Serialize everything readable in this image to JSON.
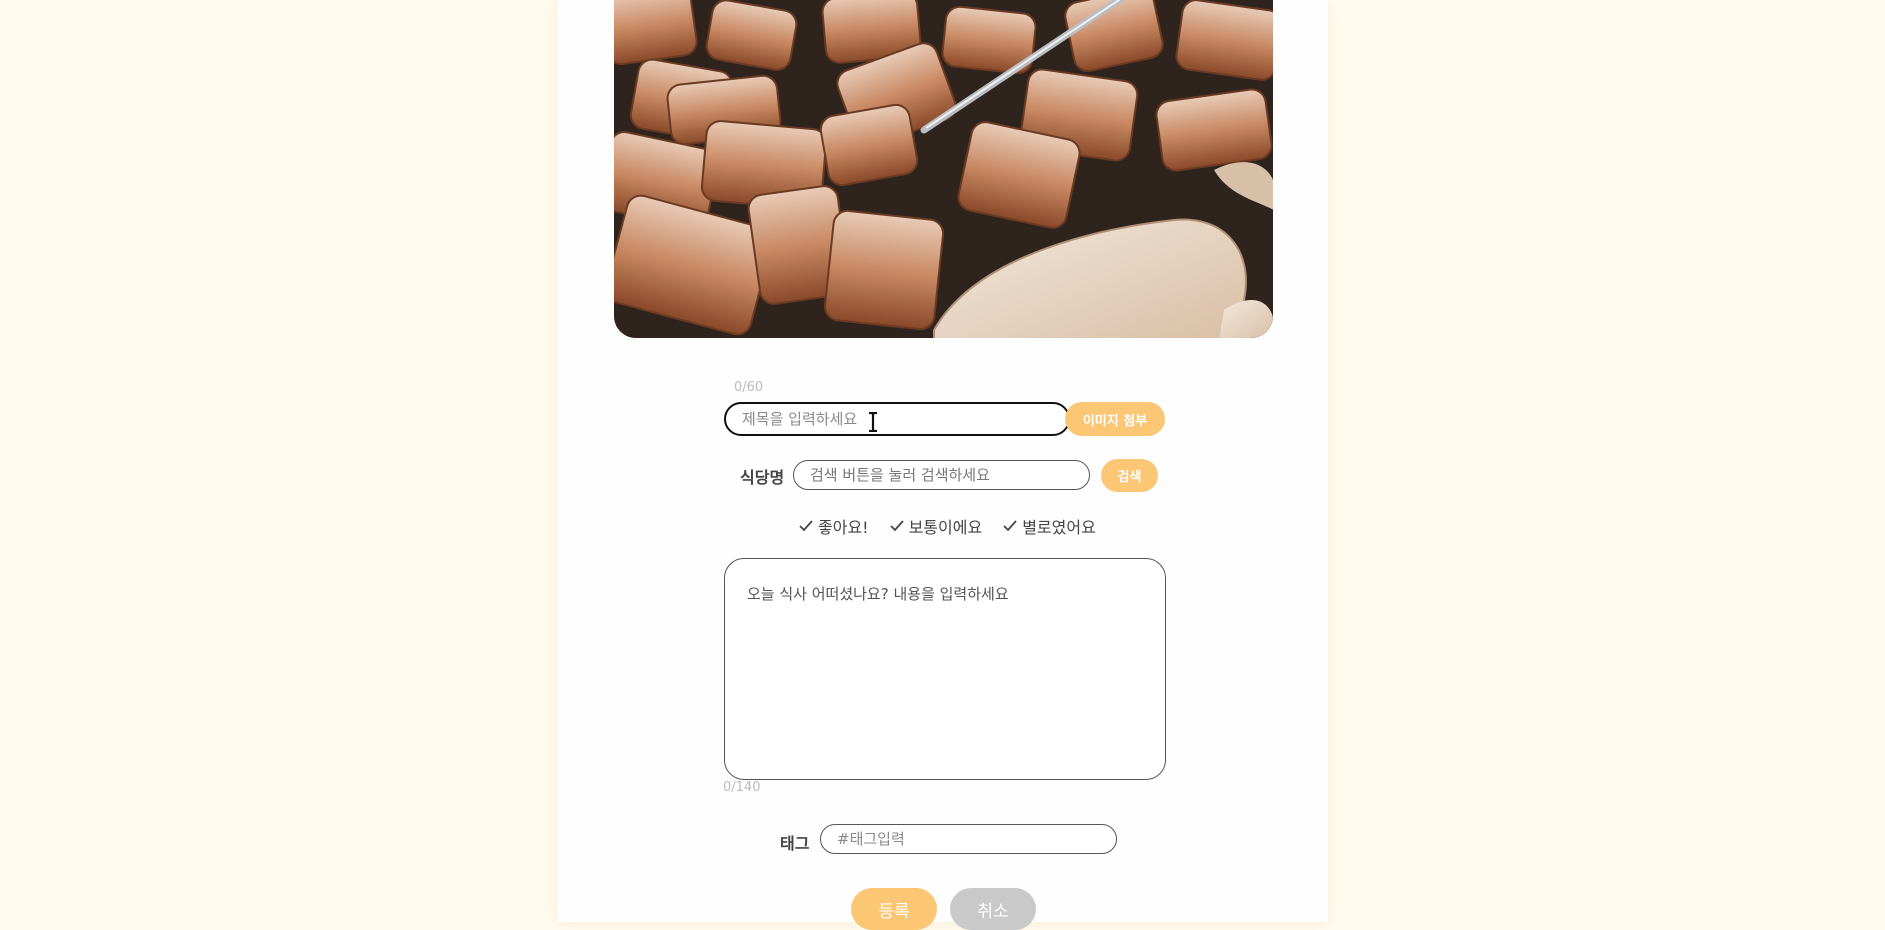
{
  "form": {
    "title_counter": "0/60",
    "title_placeholder": "제목을 입력하세요",
    "attach_image_label": "이미지 첨부",
    "restaurant_label": "식당명",
    "restaurant_placeholder": "검색 버튼을 눌러 검색하세요",
    "search_label": "검색",
    "ratings": [
      "좋아요!",
      "보통이에요",
      "별로였어요"
    ],
    "content_placeholder": "오늘 식사 어떠셨나요? 내용을 입력하세요",
    "content_counter": "0/140",
    "tag_label": "태그",
    "tag_placeholder": "#태그입력",
    "submit_label": "등록",
    "cancel_label": "취소"
  },
  "colors": {
    "page_background": "#fffbee",
    "accent": "#fcc774",
    "cancel": "#c9c9c9"
  },
  "icons": [
    "check-icon",
    "text-cursor-icon"
  ]
}
